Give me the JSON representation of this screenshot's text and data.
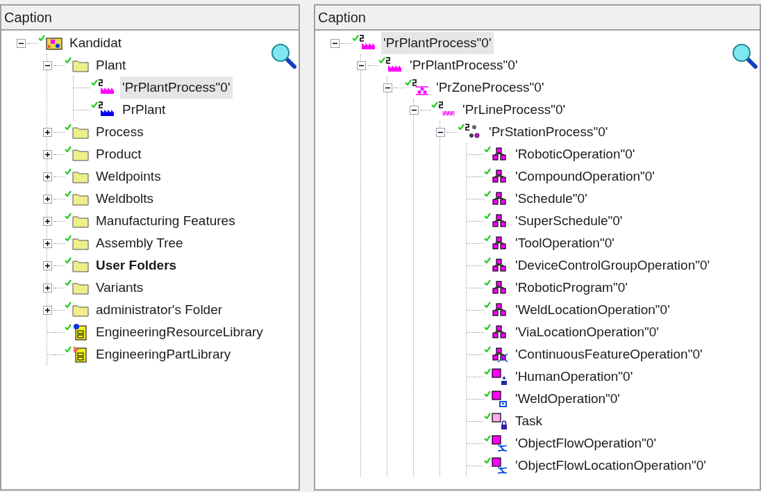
{
  "panels": [
    {
      "caption": "Caption",
      "tree": [
        {
          "label": "Kandidat",
          "kind": "project",
          "checked": true,
          "expanded": true,
          "selected": false,
          "children": [
            {
              "label": "Plant",
              "kind": "folder",
              "checked": true,
              "expanded": true,
              "selected": false,
              "children": [
                {
                  "label": "'PrPlantProcess\"0'",
                  "kind": "plant-process",
                  "checked": true,
                  "selected": true
                },
                {
                  "label": "PrPlant",
                  "kind": "plant",
                  "checked": true,
                  "selected": false
                }
              ]
            },
            {
              "label": "Process",
              "kind": "folder",
              "checked": true,
              "expanded": false,
              "selected": false
            },
            {
              "label": "Product",
              "kind": "folder",
              "checked": true,
              "expanded": false,
              "selected": false
            },
            {
              "label": "Weldpoints",
              "kind": "folder",
              "checked": true,
              "expanded": false,
              "selected": false
            },
            {
              "label": "Weldbolts",
              "kind": "folder",
              "checked": true,
              "expanded": false,
              "selected": false
            },
            {
              "label": "Manufacturing Features",
              "kind": "folder",
              "checked": true,
              "expanded": false,
              "selected": false
            },
            {
              "label": "Assembly Tree",
              "kind": "folder",
              "checked": true,
              "expanded": false,
              "selected": false
            },
            {
              "label": "User Folders",
              "kind": "folder",
              "checked": true,
              "expanded": false,
              "selected": false,
              "bold": true
            },
            {
              "label": "Variants",
              "kind": "folder",
              "checked": true,
              "expanded": false,
              "selected": false
            },
            {
              "label": "administrator's Folder",
              "kind": "folder",
              "checked": true,
              "expanded": false,
              "selected": false
            },
            {
              "label": "EngineeringResourceLibrary",
              "kind": "resource-library",
              "checked": true,
              "selected": false
            },
            {
              "label": "EngineeringPartLibrary",
              "kind": "part-library",
              "checked": true,
              "selected": false
            }
          ]
        }
      ]
    },
    {
      "caption": "Caption",
      "tree": [
        {
          "label": "'PrPlantProcess\"0'",
          "kind": "plant-process",
          "checked": true,
          "expanded": true,
          "selected": true,
          "children": [
            {
              "label": "'PrPlantProcess\"0'",
              "kind": "plant-process",
              "checked": true,
              "expanded": true,
              "selected": false,
              "children": [
                {
                  "label": "'PrZoneProcess\"0'",
                  "kind": "zone",
                  "checked": true,
                  "expanded": true,
                  "selected": false,
                  "children": [
                    {
                      "label": "'PrLineProcess\"0'",
                      "kind": "line",
                      "checked": true,
                      "expanded": true,
                      "selected": false,
                      "children": [
                        {
                          "label": "'PrStationProcess\"0'",
                          "kind": "station",
                          "checked": true,
                          "expanded": true,
                          "selected": false,
                          "children": [
                            {
                              "label": "'RoboticOperation\"0'",
                              "kind": "operation",
                              "checked": true,
                              "selected": false
                            },
                            {
                              "label": "'CompoundOperation\"0'",
                              "kind": "operation",
                              "checked": true,
                              "selected": false
                            },
                            {
                              "label": "'Schedule\"0'",
                              "kind": "operation",
                              "checked": true,
                              "selected": false
                            },
                            {
                              "label": "'SuperSchedule\"0'",
                              "kind": "operation",
                              "checked": true,
                              "selected": false
                            },
                            {
                              "label": "'ToolOperation\"0'",
                              "kind": "operation",
                              "checked": true,
                              "selected": false
                            },
                            {
                              "label": "'DeviceControlGroupOperation\"0'",
                              "kind": "operation",
                              "checked": true,
                              "selected": false
                            },
                            {
                              "label": "'RoboticProgram\"0'",
                              "kind": "operation",
                              "checked": true,
                              "selected": false
                            },
                            {
                              "label": "'WeldLocationOperation\"0'",
                              "kind": "operation",
                              "checked": true,
                              "selected": false
                            },
                            {
                              "label": "'ViaLocationOperation\"0'",
                              "kind": "operation",
                              "checked": true,
                              "selected": false
                            },
                            {
                              "label": "'ContinuousFeatureOperation\"0'",
                              "kind": "continuous-operation",
                              "checked": true,
                              "selected": false
                            },
                            {
                              "label": "'HumanOperation\"0'",
                              "kind": "human-operation",
                              "checked": true,
                              "selected": false
                            },
                            {
                              "label": "'WeldOperation\"0'",
                              "kind": "weld-operation",
                              "checked": true,
                              "selected": false
                            },
                            {
                              "label": "Task",
                              "kind": "task",
                              "checked": true,
                              "selected": false
                            },
                            {
                              "label": "'ObjectFlowOperation\"0'",
                              "kind": "flow-operation",
                              "checked": true,
                              "selected": false
                            },
                            {
                              "label": "'ObjectFlowLocationOperation\"0'",
                              "kind": "flow-operation",
                              "checked": true,
                              "selected": false
                            }
                          ]
                        }
                      ]
                    }
                  ]
                }
              ]
            }
          ]
        }
      ]
    }
  ]
}
